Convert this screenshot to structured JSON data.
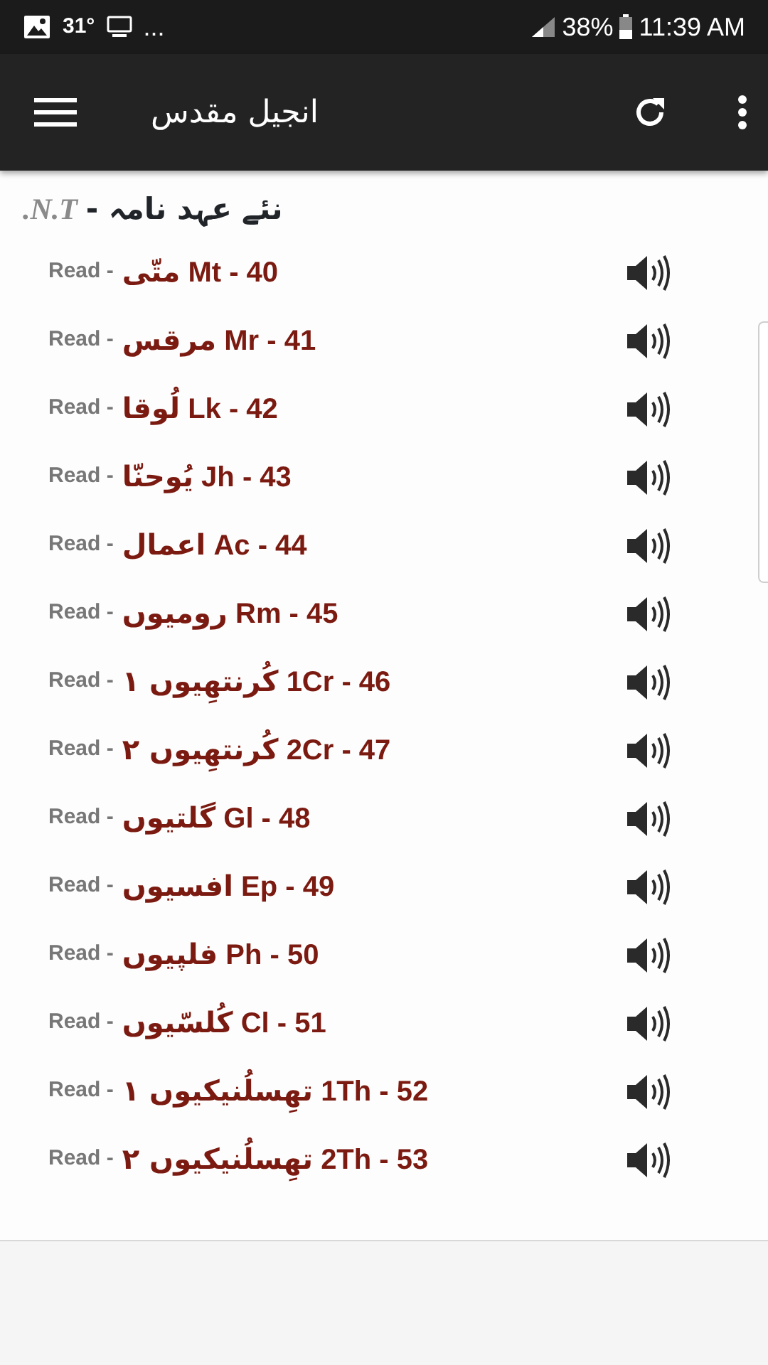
{
  "status_bar": {
    "temperature": "31°",
    "more": "...",
    "battery": "38%",
    "time": "11:39 AM"
  },
  "app_bar": {
    "title": "انجیل مقدس"
  },
  "section": {
    "title": "نئے عہد نامہ -",
    "abbr": "N.T."
  },
  "books": [
    {
      "read": "Read -",
      "name": "متّی",
      "code": "Mt - 40"
    },
    {
      "read": "Read -",
      "name": "مرقس",
      "code": "Mr - 41"
    },
    {
      "read": "Read -",
      "name": "لُوقا",
      "code": "Lk - 42"
    },
    {
      "read": "Read -",
      "name": "یُوحنّا",
      "code": "Jh - 43"
    },
    {
      "read": "Read -",
      "name": "اعمال",
      "code": "Ac - 44"
    },
    {
      "read": "Read -",
      "name": "رومیوں",
      "code": "Rm - 45"
    },
    {
      "read": "Read -",
      "name": "کُرنتھِیوں ١",
      "code": "1Cr - 46"
    },
    {
      "read": "Read -",
      "name": "کُرنتھِیوں ٢",
      "code": "2Cr - 47"
    },
    {
      "read": "Read -",
      "name": "گلتیوں",
      "code": "Gl - 48"
    },
    {
      "read": "Read -",
      "name": "افسیوں",
      "code": "Ep - 49"
    },
    {
      "read": "Read -",
      "name": "فلپیوں",
      "code": "Ph - 50"
    },
    {
      "read": "Read -",
      "name": "کُلسّیوں",
      "code": "Cl - 51"
    },
    {
      "read": "Read -",
      "name": "تھِسلُنیکیوں ١",
      "code": "1Th - 52"
    },
    {
      "read": "Read -",
      "name": "تھِسلُنیکیوں ٢",
      "code": "2Th - 53"
    }
  ]
}
